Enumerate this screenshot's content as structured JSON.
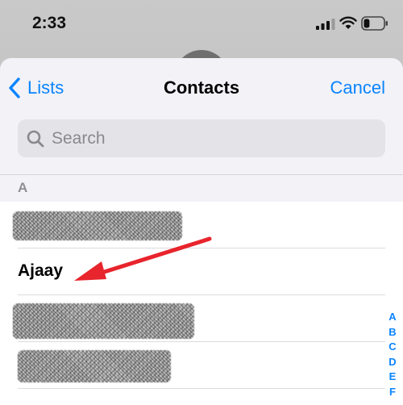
{
  "status_bar": {
    "time": "2:33",
    "signal_icon": "cellular-signal-icon",
    "wifi_icon": "wifi-icon",
    "battery_icon": "battery-icon",
    "battery_level": 0.3
  },
  "nav": {
    "back_label": "Lists",
    "title": "Contacts",
    "cancel_label": "Cancel"
  },
  "search": {
    "placeholder": "Search",
    "value": ""
  },
  "section": {
    "letter": "A"
  },
  "contacts": [
    {
      "name": "",
      "redacted": true
    },
    {
      "name": "Ajaay",
      "redacted": false
    },
    {
      "name": "",
      "redacted": true
    },
    {
      "name": "",
      "redacted": true
    }
  ],
  "index_letters": [
    "A",
    "B",
    "C",
    "D",
    "E",
    "F"
  ],
  "colors": {
    "accent": "#0a84ff",
    "annotation": "#e8242c"
  }
}
